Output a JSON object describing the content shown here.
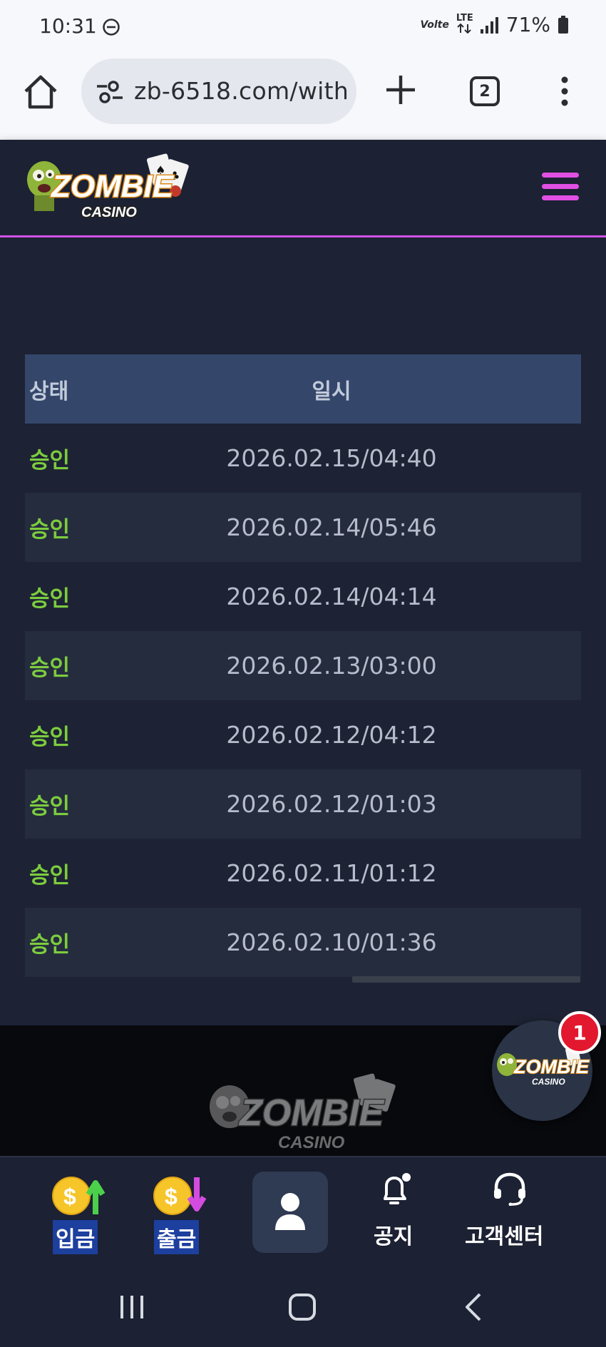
{
  "status_bar": {
    "time": "10:31",
    "volte": "Volte",
    "lte": "LTE",
    "battery": "71%"
  },
  "browser": {
    "url": "zb-6518.com/with",
    "tab_count": "2"
  },
  "header": {
    "logo_name": "ZOMBIE",
    "logo_sub": "CASINO"
  },
  "table": {
    "columns": [
      "상태",
      "일시"
    ],
    "rows": [
      {
        "status": "승인",
        "date": "2026.02.15/04:40"
      },
      {
        "status": "승인",
        "date": "2026.02.14/05:46"
      },
      {
        "status": "승인",
        "date": "2026.02.14/04:14"
      },
      {
        "status": "승인",
        "date": "2026.02.13/03:00"
      },
      {
        "status": "승인",
        "date": "2026.02.12/04:12"
      },
      {
        "status": "승인",
        "date": "2026.02.12/01:03"
      },
      {
        "status": "승인",
        "date": "2026.02.11/01:12"
      },
      {
        "status": "승인",
        "date": "2026.02.10/01:36"
      }
    ]
  },
  "floating": {
    "badge_count": "1",
    "logo_name": "ZOMBIE",
    "logo_sub": "CASINO"
  },
  "bottom_nav": {
    "deposit": "입금",
    "withdraw": "출금",
    "notice": "공지",
    "support": "고객센터"
  },
  "colors": {
    "accent": "#e24fe4",
    "approved": "#7ccc3e",
    "table_header": "#34466a",
    "badge": "#e2182f"
  }
}
